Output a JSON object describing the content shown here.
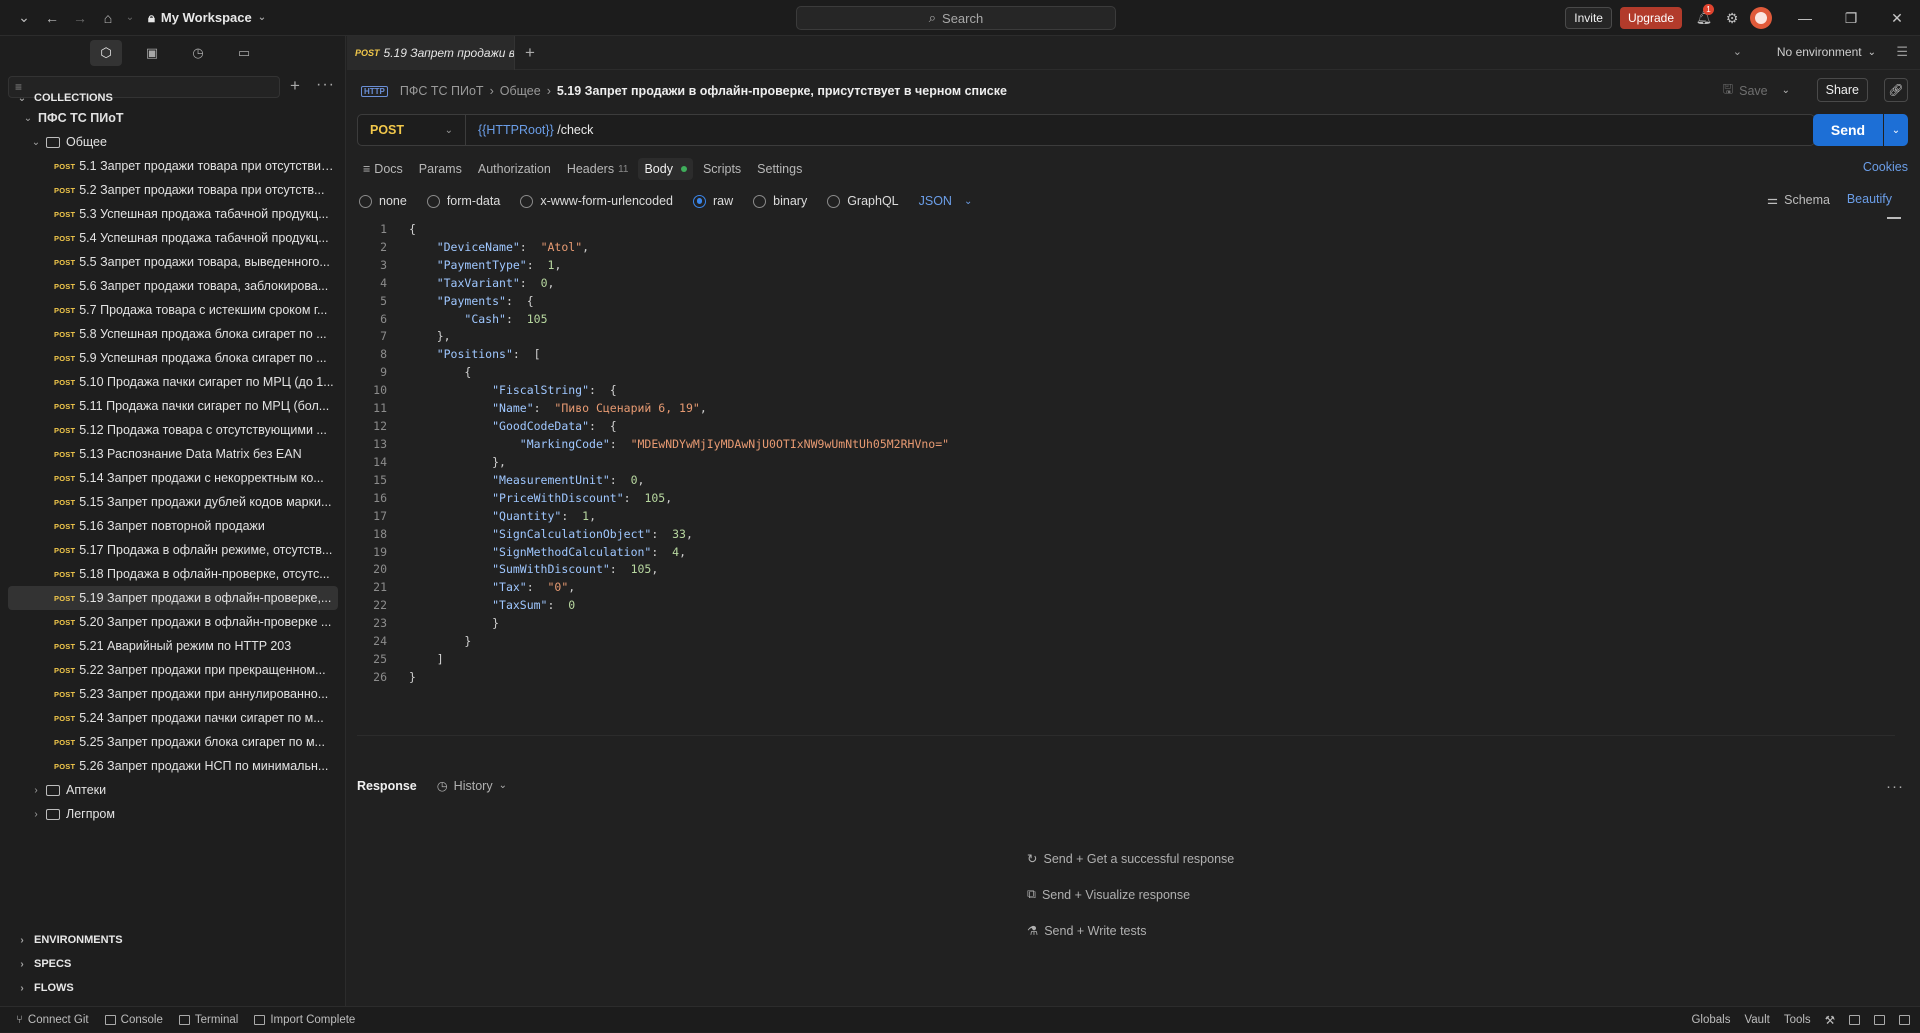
{
  "titlebar": {
    "workspace": "My Workspace",
    "search_placeholder": "Search",
    "invite": "Invite",
    "upgrade": "Upgrade",
    "notification_count": "1"
  },
  "sidebar": {
    "collections_label": "COLLECTIONS",
    "collection_name": "ПФС ТС ПИоТ",
    "folder_open": "Общее",
    "method_tag": "POST",
    "requests": [
      "5.1 Запрет продажи товара при отсутствии...",
      "5.2 Запрет продажи товара при отсутств...",
      "5.3 Успешная продажа табачной продукц...",
      "5.4 Успешная продажа табачной продукц...",
      "5.5 Запрет продажи товара, выведенного...",
      "5.6 Запрет продажи товара, заблокирова...",
      "5.7 Продажа товара с истекшим сроком г...",
      "5.8 Успешная продажа блока сигарет по ...",
      "5.9 Успешная продажа блока сигарет по ...",
      "5.10 Продажа пачки сигарет по МРЦ (до 1...",
      "5.11 Продажа пачки сигарет по МРЦ (бол...",
      "5.12 Продажа товара с отсутствующими ...",
      "5.13 Распознание Data Matrix без EAN",
      "5.14 Запрет продажи с некорректным ко...",
      "5.15 Запрет продажи дублей кодов марки...",
      "5.16 Запрет повторной продажи",
      "5.17 Продажа в офлайн режиме, отсутств...",
      "5.18 Продажа в офлайн-проверке, отсутс...",
      "5.19 Запрет продажи в офлайн-проверке,...",
      "5.20 Запрет продажи в офлайн-проверке ...",
      "5.21 Аварийный режим по HTTP 203",
      "5.22 Запрет продажи при прекращенном...",
      "5.23 Запрет продажи при аннулированно...",
      "5.24 Запрет продажи пачки сигарет по м...",
      "5.25 Запрет продажи блока сигарет по м...",
      "5.26 Запрет продажи НСП по минимальн..."
    ],
    "active_index": 18,
    "folders_closed": [
      "Аптеки",
      "Легпром"
    ],
    "environments_label": "ENVIRONMENTS",
    "specs_label": "SPECS",
    "flows_label": "FLOWS"
  },
  "tabbar": {
    "tab_method": "POST",
    "tab_title": "5.19 Запрет продажи в",
    "environment": "No environment"
  },
  "breadcrumb": {
    "collection": "ПФС ТС ПИоТ",
    "folder": "Общее",
    "current": "5.19 Запрет продажи в офлайн-проверке, присутствует в черном списке",
    "save": "Save",
    "share": "Share"
  },
  "request": {
    "method": "POST",
    "url_var": "{{HTTPRoot}}",
    "url_path": " /check",
    "send": "Send",
    "tabs": [
      "Docs",
      "Params",
      "Authorization",
      "Headers",
      "Body",
      "Scripts",
      "Settings"
    ],
    "headers_count": "11",
    "cookies": "Cookies",
    "body_types": [
      "none",
      "form-data",
      "x-www-form-urlencoded",
      "raw",
      "binary",
      "GraphQL"
    ],
    "body_format": "JSON",
    "schema": "Schema",
    "beautify": "Beautify"
  },
  "code_lines": [
    "{",
    "    \"DeviceName\":  \"Atol\",",
    "    \"PaymentType\":  1,",
    "    \"TaxVariant\":  0,",
    "    \"Payments\":  {",
    "        \"Cash\":  105",
    "    },",
    "    \"Positions\":  [",
    "        {",
    "            \"FiscalString\":  {",
    "            \"Name\":  \"Пиво Сценарий 6, 19\",",
    "            \"GoodCodeData\":  {",
    "                \"MarkingCode\":  \"MDEwNDYwMjIyMDAwNjU0OTIxNW9wUmNtUh05M2RHVno=\"",
    "            },",
    "            \"MeasurementUnit\":  0,",
    "            \"PriceWithDiscount\":  105,",
    "            \"Quantity\":  1,",
    "            \"SignCalculationObject\":  33,",
    "            \"SignMethodCalculation\":  4,",
    "            \"SumWithDiscount\":  105,",
    "            \"Tax\":  \"0\",",
    "            \"TaxSum\":  0",
    "            }",
    "        }",
    "    ]",
    "}"
  ],
  "response": {
    "title": "Response",
    "history": "History",
    "hints": [
      "Send + Get a successful response",
      "Send + Visualize response",
      "Send + Write tests"
    ]
  },
  "statusbar": {
    "left": [
      "Connect Git",
      "Console",
      "Terminal",
      "Import Complete"
    ],
    "right": [
      "Globals",
      "Vault",
      "Tools"
    ]
  }
}
